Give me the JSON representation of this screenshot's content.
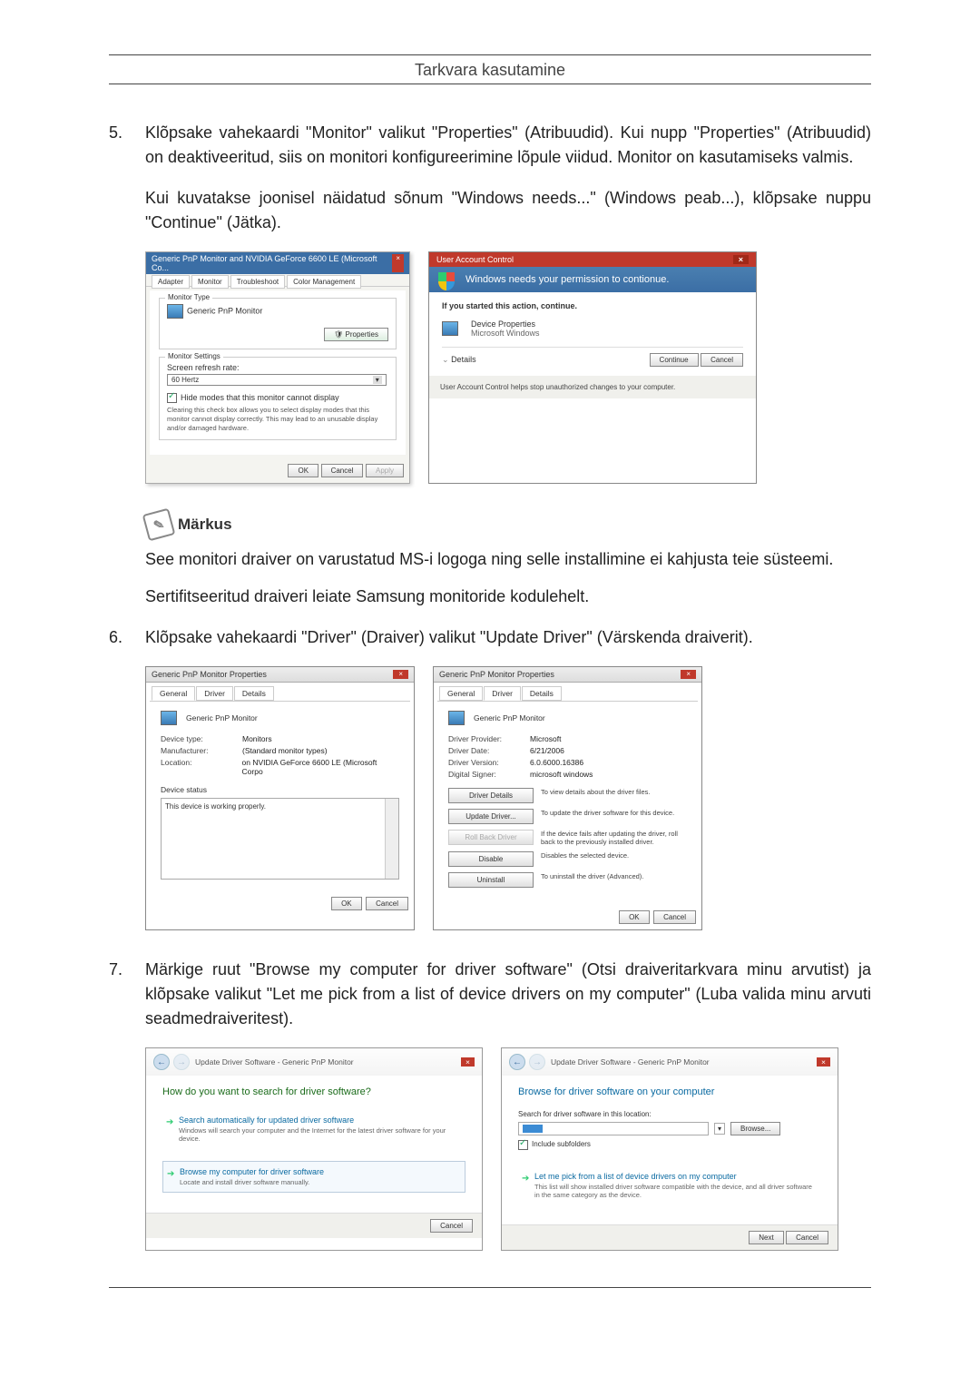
{
  "header": {
    "title": "Tarkvara kasutamine"
  },
  "steps": {
    "s5": {
      "num": "5.",
      "text": "Klõpsake vahekaardi \"Monitor\" valikut \"Properties\" (Atribuudid). Kui nupp \"Properties\" (Atribuudid) on deaktiveeritud, siis on monitori konfigureerimine lõpule viidud. Monitor on kasutamiseks valmis.",
      "sub": "Kui kuvatakse joonisel näidatud sõnum \"Windows needs...\" (Windows peab...), klõpsake nuppu \"Continue\" (Jätka)."
    },
    "s6": {
      "num": "6.",
      "text": "Klõpsake vahekaardi \"Driver\" (Draiver) valikut \"Update Driver\" (Värskenda draiverit)."
    },
    "s7": {
      "num": "7.",
      "text": "Märkige ruut \"Browse my computer for driver software\" (Otsi draiveritarkvara minu arvutist) ja klõpsake valikut \"Let me pick from a list of device drivers on my computer\" (Luba valida minu arvuti seadmedraiveritest)."
    }
  },
  "note": {
    "label": "Märkus",
    "p1": "See monitori draiver on varustatud MS-i logoga ning selle installimine ei kahjusta teie süsteemi.",
    "p2": "Sertifitseeritud draiveri leiate Samsung monitoride kodulehelt."
  },
  "dlg1": {
    "title": "Generic PnP Monitor and NVIDIA GeForce 6600 LE (Microsoft Co...",
    "tabs": [
      "Adapter",
      "Monitor",
      "Troubleshoot",
      "Color Management"
    ],
    "monitorType": "Monitor Type",
    "monitorName": "Generic PnP Monitor",
    "propertiesBtn": "Properties",
    "settingsLegend": "Monitor Settings",
    "refreshLabel": "Screen refresh rate:",
    "refreshValue": "60 Hertz",
    "hideModes": "Hide modes that this monitor cannot display",
    "hideDesc": "Clearing this check box allows you to select display modes that this monitor cannot display correctly. This may lead to an unusable display and/or damaged hardware.",
    "ok": "OK",
    "cancel": "Cancel",
    "apply": "Apply"
  },
  "uac": {
    "title": "User Account Control",
    "band": "Windows needs your permission to contionue.",
    "line1": "If you started this action, continue.",
    "devProp": "Device Properties",
    "msWin": "Microsoft Windows",
    "details": "Details",
    "continue": "Continue",
    "cancel": "Cancel",
    "footer": "User Account Control helps stop unauthorized changes to your computer."
  },
  "propGeneral": {
    "title": "Generic PnP Monitor Properties",
    "tabs": [
      "General",
      "Driver",
      "Details"
    ],
    "name": "Generic PnP Monitor",
    "devType": "Device type:",
    "devTypeV": "Monitors",
    "manu": "Manufacturer:",
    "manuV": "(Standard monitor types)",
    "loc": "Location:",
    "locV": "on NVIDIA GeForce 6600 LE (Microsoft Corpo",
    "statusLegend": "Device status",
    "statusText": "This device is working properly.",
    "ok": "OK",
    "cancel": "Cancel"
  },
  "propDriver": {
    "title": "Generic PnP Monitor Properties",
    "tabs": [
      "General",
      "Driver",
      "Details"
    ],
    "name": "Generic PnP Monitor",
    "provider": "Driver Provider:",
    "providerV": "Microsoft",
    "date": "Driver Date:",
    "dateV": "6/21/2006",
    "version": "Driver Version:",
    "versionV": "6.0.6000.16386",
    "signer": "Digital Signer:",
    "signerV": "microsoft windows",
    "btnDetails": "Driver Details",
    "descDetails": "To view details about the driver files.",
    "btnUpdate": "Update Driver...",
    "descUpdate": "To update the driver software for this device.",
    "btnRollback": "Roll Back Driver",
    "descRollback": "If the device fails after updating the driver, roll back to the previously installed driver.",
    "btnDisable": "Disable",
    "descDisable": "Disables the selected device.",
    "btnUninstall": "Uninstall",
    "descUninstall": "To uninstall the driver (Advanced).",
    "ok": "OK",
    "cancel": "Cancel"
  },
  "wiz1": {
    "crumb": "Update Driver Software - Generic PnP Monitor",
    "heading": "How do you want to search for driver software?",
    "opt1Title": "Search automatically for updated driver software",
    "opt1Desc": "Windows will search your computer and the Internet for the latest driver software for your device.",
    "opt2Title": "Browse my computer for driver software",
    "opt2Desc": "Locate and install driver software manually.",
    "cancel": "Cancel"
  },
  "wiz2": {
    "crumb": "Update Driver Software - Generic PnP Monitor",
    "heading": "Browse for driver software on your computer",
    "searchLabel": "Search for driver software in this location:",
    "browse": "Browse...",
    "include": "Include subfolders",
    "opt1Title": "Let me pick from a list of device drivers on my computer",
    "opt1Desc": "This list will show installed driver software compatible with the device, and all driver software in the same category as the device.",
    "next": "Next",
    "cancel": "Cancel"
  }
}
